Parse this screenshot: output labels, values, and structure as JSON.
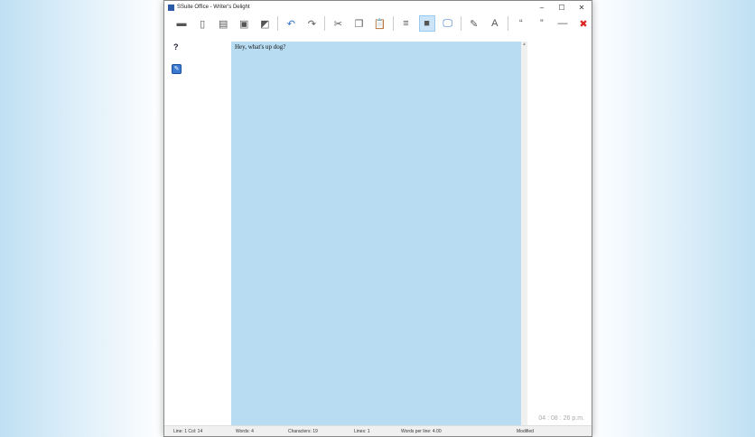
{
  "window": {
    "title": "SSuite Office - Writer's Delight",
    "min": "–",
    "max": "☐",
    "close": "✕"
  },
  "toolbar": [
    {
      "name": "new-icon",
      "glyph": "▬"
    },
    {
      "name": "copy-doc-icon",
      "glyph": "▯"
    },
    {
      "name": "open-icon",
      "glyph": "▤"
    },
    {
      "name": "save-icon",
      "glyph": "▣"
    },
    {
      "name": "save-as-icon",
      "glyph": "◩"
    },
    {
      "name": "undo-icon",
      "glyph": "↶"
    },
    {
      "name": "redo-icon",
      "glyph": "↷"
    },
    {
      "name": "cut-icon",
      "glyph": "✂"
    },
    {
      "name": "copy-icon",
      "glyph": "❐"
    },
    {
      "name": "paste-icon",
      "glyph": "📋"
    },
    {
      "name": "line-spacing-icon",
      "glyph": "≡"
    },
    {
      "name": "page-view-icon",
      "glyph": "■"
    },
    {
      "name": "monitor-icon",
      "glyph": "🖵"
    },
    {
      "name": "edit-icon",
      "glyph": "✎"
    },
    {
      "name": "font-icon",
      "glyph": "A"
    },
    {
      "name": "open-quote-icon",
      "glyph": "“"
    },
    {
      "name": "close-quote-icon",
      "glyph": "”"
    },
    {
      "name": "dash-icon",
      "glyph": "—"
    },
    {
      "name": "exit-icon",
      "glyph": "✖"
    }
  ],
  "side": {
    "help": "?",
    "edit": "✎"
  },
  "document": {
    "text": "Hey, what's up dog?"
  },
  "clock": "04 : 08 : 26 p.m.",
  "status": {
    "linecol": "Line:  1  Col:  14",
    "words": "Words: 4",
    "chars": "Characters: 19",
    "lines": "Lines: 1",
    "wpl": "Words per line:     4.00",
    "modified": "Modified"
  }
}
